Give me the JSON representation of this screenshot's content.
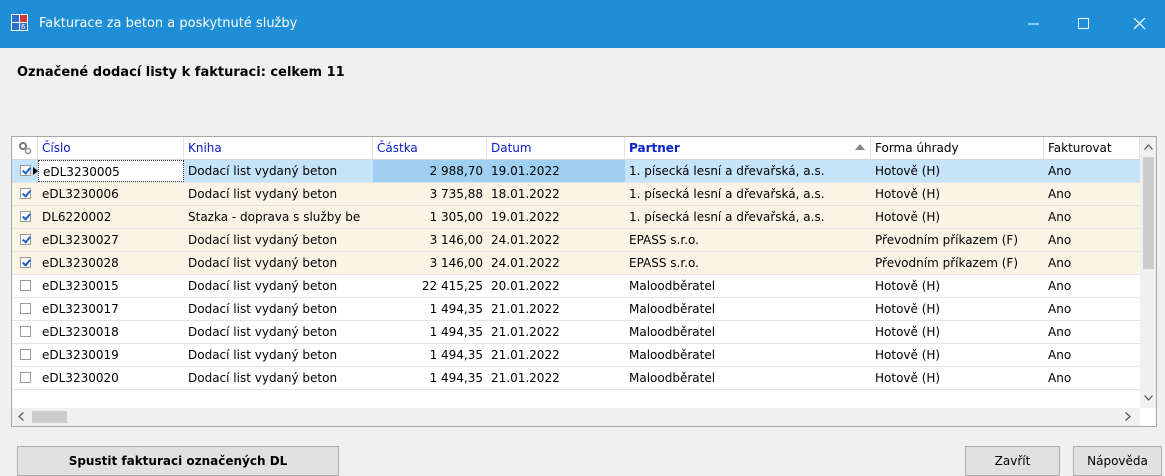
{
  "window": {
    "title": "Fakturace za beton a poskytnuté služby",
    "title_bar_color": "#1e8fd6"
  },
  "heading": "Označené dodací listy k fakturaci: celkem 11",
  "table": {
    "columns": [
      {
        "key": "cislo",
        "label": "Číslo"
      },
      {
        "key": "kniha",
        "label": "Kniha"
      },
      {
        "key": "castka",
        "label": "Částka"
      },
      {
        "key": "datum",
        "label": "Datum"
      },
      {
        "key": "partner",
        "label": "Partner"
      },
      {
        "key": "forma",
        "label": "Forma úhrady"
      },
      {
        "key": "fakturovat",
        "label": "Fakturovat"
      }
    ],
    "sorted_by": "Partner",
    "rows": [
      {
        "checked": true,
        "current": true,
        "cislo": "eDL3230005",
        "kniha": "Dodací list vydaný beton",
        "castka": "2 988,70",
        "datum": "19.01.2022",
        "partner": "1. písecká lesní a dřevařská, a.s.",
        "forma": "Hotově (H)",
        "fakturovat": "Ano"
      },
      {
        "checked": true,
        "cislo": "eDL3230006",
        "kniha": "Dodací list vydaný beton",
        "castka": "3 735,88",
        "datum": "18.01.2022",
        "partner": "1. písecká lesní a dřevařská, a.s.",
        "forma": "Hotově (H)",
        "fakturovat": "Ano"
      },
      {
        "checked": true,
        "cislo": "DL6220002",
        "kniha": "Stazka - doprava s služby be",
        "castka": "1 305,00",
        "datum": "19.01.2022",
        "partner": "1. písecká lesní a dřevařská, a.s.",
        "forma": "Hotově (H)",
        "fakturovat": "Ano"
      },
      {
        "checked": true,
        "cislo": "eDL3230027",
        "kniha": "Dodací list vydaný beton",
        "castka": "3 146,00",
        "datum": "24.01.2022",
        "partner": "EPASS s.r.o.",
        "forma": "Převodním příkazem (F)",
        "fakturovat": "Ano"
      },
      {
        "checked": true,
        "cislo": "eDL3230028",
        "kniha": "Dodací list vydaný beton",
        "castka": "3 146,00",
        "datum": "24.01.2022",
        "partner": "EPASS s.r.o.",
        "forma": "Převodním příkazem (F)",
        "fakturovat": "Ano"
      },
      {
        "checked": false,
        "cislo": "eDL3230015",
        "kniha": "Dodací list vydaný beton",
        "castka": "22 415,25",
        "datum": "20.01.2022",
        "partner": "Maloodběratel",
        "forma": "Hotově (H)",
        "fakturovat": "Ano"
      },
      {
        "checked": false,
        "cislo": "eDL3230017",
        "kniha": "Dodací list vydaný beton",
        "castka": "1 494,35",
        "datum": "21.01.2022",
        "partner": "Maloodběratel",
        "forma": "Hotově (H)",
        "fakturovat": "Ano"
      },
      {
        "checked": false,
        "cislo": "eDL3230018",
        "kniha": "Dodací list vydaný beton",
        "castka": "1 494,35",
        "datum": "21.01.2022",
        "partner": "Maloodběratel",
        "forma": "Hotově (H)",
        "fakturovat": "Ano"
      },
      {
        "checked": false,
        "cislo": "eDL3230019",
        "kniha": "Dodací list vydaný beton",
        "castka": "1 494,35",
        "datum": "21.01.2022",
        "partner": "Maloodběratel",
        "forma": "Hotově (H)",
        "fakturovat": "Ano"
      },
      {
        "checked": false,
        "cislo": "eDL3230020",
        "kniha": "Dodací list vydaný beton",
        "castka": "1 494,35",
        "datum": "21.01.2022",
        "partner": "Maloodběratel",
        "forma": "Hotově (H)",
        "fakturovat": "Ano"
      }
    ]
  },
  "buttons": {
    "start": "Spustit fakturaci označených DL",
    "close": "Zavřít",
    "help": "Nápověda"
  },
  "icons": [
    "app-icon",
    "minimize-icon",
    "maximize-icon",
    "close-icon",
    "column-settings-icon",
    "scroll-up-icon",
    "scroll-down-icon",
    "scroll-left-icon",
    "scroll-right-icon"
  ]
}
